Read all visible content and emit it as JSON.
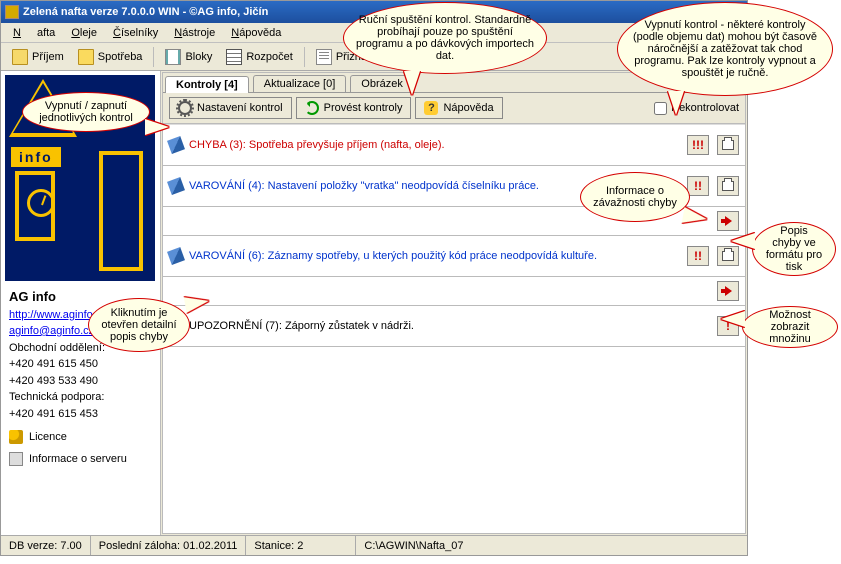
{
  "title": "Zelená nafta verze 7.0.0.0 WIN - ©AG info, Jičín",
  "menu": [
    "Nafta",
    "Oleje",
    "Číselníky",
    "Nástroje",
    "Nápověda"
  ],
  "menu_accel": [
    "N",
    "O",
    "Č",
    "N",
    "N"
  ],
  "toolbar": [
    {
      "label": "Příjem",
      "icon": "folder"
    },
    {
      "label": "Spotřeba",
      "icon": "folder"
    },
    {
      "label": "Bloky",
      "icon": "sheet"
    },
    {
      "label": "Rozpočet",
      "icon": "grid"
    },
    {
      "label": "Přiznání",
      "icon": "doc"
    }
  ],
  "sidebar": {
    "logo_text": "info",
    "company": "AG info",
    "links": [
      "http://www.aginfo.cz",
      "aginfo@aginfo.cz"
    ],
    "sales_label": "Obchodní oddělení:",
    "sales": [
      "+420 491 615 450",
      "+420 493 533 490"
    ],
    "support_label": "Technická podpora:",
    "support": [
      "+420 491 615 453"
    ],
    "licence": "Licence",
    "server": "Informace o serveru"
  },
  "tabs": [
    {
      "label": "Kontroly [4]",
      "active": true
    },
    {
      "label": "Aktualizace [0]",
      "active": false
    },
    {
      "label": "Obrázek",
      "active": false
    }
  ],
  "buttons": {
    "settings": "Nastavení kontrol",
    "run": "Provést kontroly",
    "help": "Nápověda",
    "nocheck": "Nekontrolovat"
  },
  "rows": [
    {
      "type": "err",
      "text": "CHYBA (3): Spotřeba převyšuje příjem (nafta, oleje).",
      "excl": "!!!",
      "print": true,
      "detail": false
    },
    {
      "type": "warn",
      "text": "VAROVÁNÍ (4): Nastavení položky \"vratka\" neodpovídá číselníku práce.",
      "excl": "!!",
      "print": true,
      "detail": true
    },
    {
      "type": "warn",
      "text": "VAROVÁNÍ (6): Záznamy spotřeby, u kterých použitý kód práce neodpovídá kultuře.",
      "excl": "!!",
      "print": true,
      "detail": true
    },
    {
      "type": "info",
      "text": "UPOZORNĚNÍ (7): Záporný zůstatek v nádrži.",
      "excl": "!",
      "print": false,
      "detail": false
    }
  ],
  "status": {
    "db": "DB verze: 7.00",
    "backup": "Poslední záloha: 01.02.2011",
    "station": "Stanice: 2",
    "path": "C:\\AGWIN\\Nafta_07"
  },
  "callouts": {
    "c1": "Vypnutí / zapnutí jednotlivých kontrol",
    "c2": "Ruční spuštění kontrol. Standardně probíhají pouze po spuštění programu a po dávkových importech dat.",
    "c3": "Vypnutí kontrol - některé kontroly (podle objemu dat) mohou být časově náročnější a zatěžovat tak chod programu. Pak lze kontroly vypnout a spouštět je ručně.",
    "c4": "Informace o závažnosti chyby",
    "c5": "Popis chyby ve formátu pro tisk",
    "c6": "Kliknutím je otevřen detailní popis chyby",
    "c7": "Možnost zobrazit množinu"
  }
}
